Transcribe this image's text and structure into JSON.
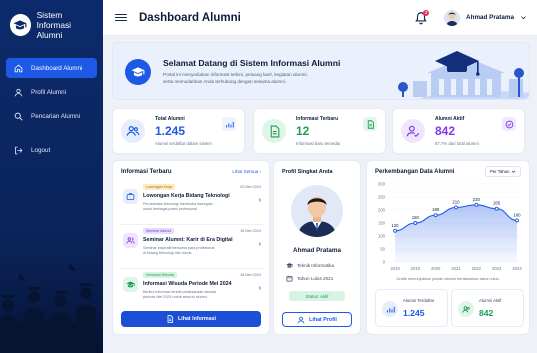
{
  "brand": {
    "title_line1": "Sistem Informasi",
    "title_line2": "Alumni"
  },
  "sidebar": {
    "items": [
      {
        "label": "Dashboard Alumni",
        "icon": "home-icon",
        "active": true
      },
      {
        "label": "Profil Alumni",
        "icon": "user-icon",
        "active": false
      },
      {
        "label": "Pencarian Alumni",
        "icon": "search-icon",
        "active": false
      }
    ],
    "logout_label": "Logout"
  },
  "header": {
    "title": "Dashboard Alumni",
    "user_name": "Ahmad Pratama",
    "notification_count": "3"
  },
  "welcome": {
    "title": "Selamat Datang di Sistem Informasi Alumni",
    "line1": "Portal ini menyediakan informasi terkini, peluang karir, kegiatan alumni,",
    "line2": "serta memudahkan Anda terhubung dengan sesama alumni."
  },
  "stats": [
    {
      "label": "Total Alumni",
      "value": "1.245",
      "sub": "Alumni terdaftar dalam sistem",
      "color": "#1e59e6"
    },
    {
      "label": "Informasi Terbaru",
      "value": "12",
      "sub": "Informasi baru tersedia",
      "color": "#1f9d57"
    },
    {
      "label": "Alumni Aktif",
      "value": "842",
      "sub": "67,7% dari total alumni",
      "color": "#7c3aed"
    }
  ],
  "info": {
    "title": "Informasi Terbaru",
    "see_all": "Lihat Semua",
    "items": [
      {
        "tag": "Lowongan Kerja",
        "date": "20 Mei 2024",
        "title": "Lowongan Kerja Bidang Teknologi",
        "desc1": "Perusahaan teknologi membuka lowongan",
        "desc2": "untuk berbagai posisi profesional."
      },
      {
        "tag": "Seminar Alumni",
        "date": "15 Mei 2024",
        "title": "Seminar Alumni: Karir di Era Digital",
        "desc1": "Seminar inspiratif bersama para profesional",
        "desc2": "di bidang teknologi dan bisnis."
      },
      {
        "tag": "Informasi Wisuda",
        "date": "18 Mei 2024",
        "title": "Informasi Wisuda Periode Mei 2024",
        "desc1": "Berikut informasi terkait pelaksanaan wisuda",
        "desc2": "periode Mei 2024 untuk seluruh alumni."
      }
    ],
    "button": "Lihat Informasi"
  },
  "profile": {
    "title": "Profil Singkat Anda",
    "name": "Ahmad Pratama",
    "major": "Teknik Informatika",
    "graduation": "Tahun Lulus 2021",
    "status": "Status: Aktif",
    "button": "Lihat Profil"
  },
  "chart_panel": {
    "title": "Perkembangan Data Alumni",
    "period": "Per Tahun",
    "note": "Grafik menunjukkan jumlah alumni berdasarkan tahun lulus.",
    "mini": [
      {
        "label": "Alumni Terdaftar",
        "value": "1.245"
      },
      {
        "label": "Alumni Aktif",
        "value": "842"
      }
    ]
  },
  "chart_data": {
    "type": "area",
    "categories": [
      "2018",
      "2019",
      "2020",
      "2021",
      "2022",
      "2023",
      "2024"
    ],
    "values": [
      120,
      150,
      180,
      210,
      220,
      205,
      160
    ],
    "ylim": [
      0,
      300
    ],
    "yticks": [
      0,
      50,
      100,
      150,
      200,
      250,
      300
    ],
    "grid": true,
    "color": "#1e59e6"
  }
}
